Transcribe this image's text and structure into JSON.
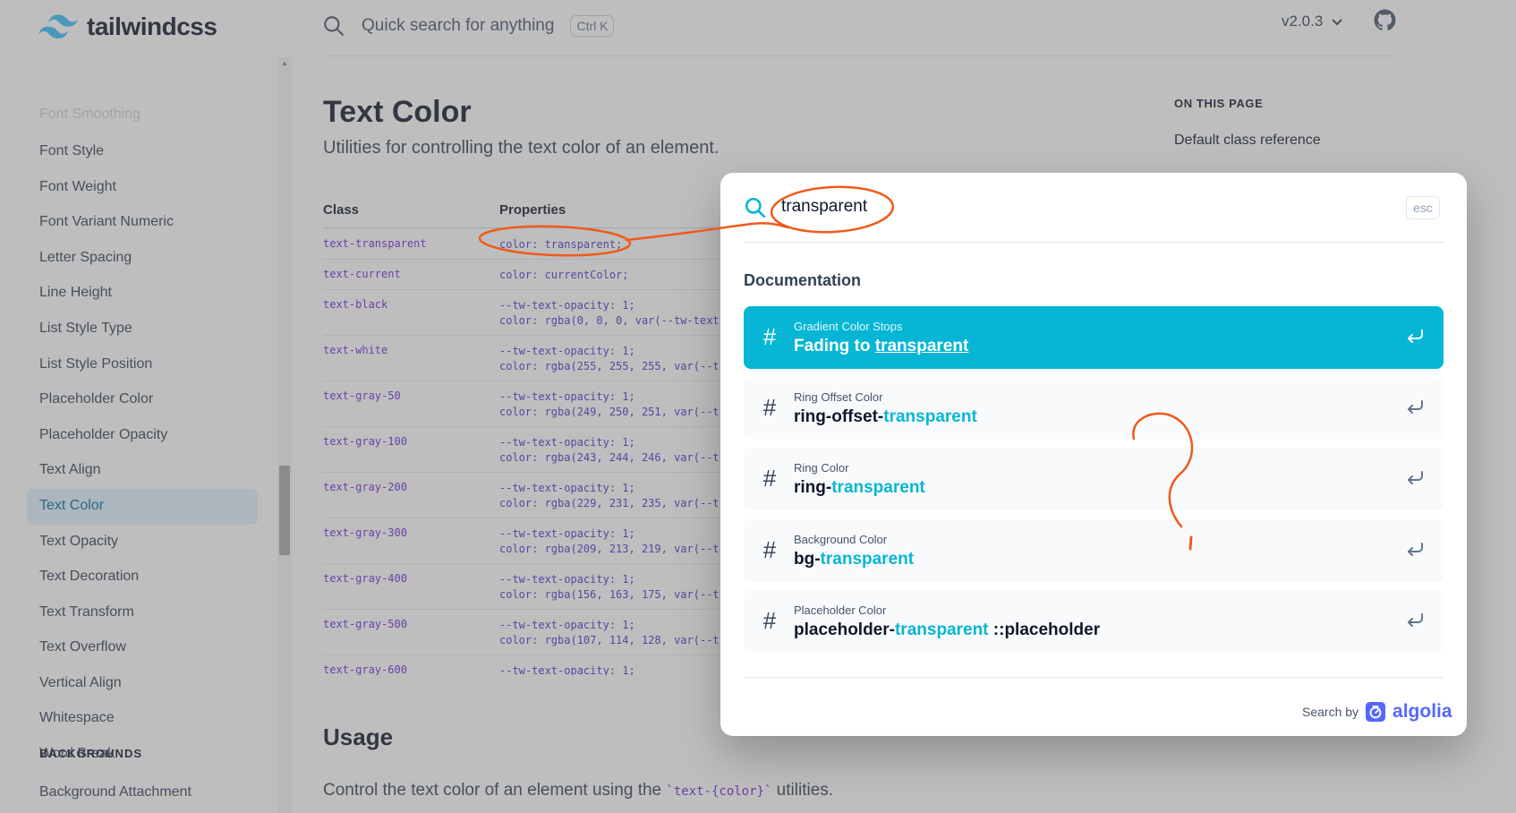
{
  "header": {
    "logo_text": "tailwindcss",
    "search_placeholder": "Quick search for anything",
    "search_shortcut": "Ctrl K",
    "version": "v2.0.3"
  },
  "sidebar": {
    "items": [
      {
        "label": "Font Smoothing"
      },
      {
        "label": "Font Style"
      },
      {
        "label": "Font Weight"
      },
      {
        "label": "Font Variant Numeric"
      },
      {
        "label": "Letter Spacing"
      },
      {
        "label": "Line Height"
      },
      {
        "label": "List Style Type"
      },
      {
        "label": "List Style Position"
      },
      {
        "label": "Placeholder Color"
      },
      {
        "label": "Placeholder Opacity"
      },
      {
        "label": "Text Align"
      },
      {
        "label": "Text Color"
      },
      {
        "label": "Text Opacity"
      },
      {
        "label": "Text Decoration"
      },
      {
        "label": "Text Transform"
      },
      {
        "label": "Text Overflow"
      },
      {
        "label": "Vertical Align"
      },
      {
        "label": "Whitespace"
      },
      {
        "label": "Word Break"
      }
    ],
    "active_item": "Text Color",
    "section_heading": "BACKGROUNDS",
    "section_first_item": "Background Attachment"
  },
  "main": {
    "title": "Text Color",
    "subtitle": "Utilities for controlling the text color of an element.",
    "table": {
      "headers": [
        "Class",
        "Properties"
      ],
      "rows": [
        {
          "cls": "text-transparent",
          "prop": "color: transparent;"
        },
        {
          "cls": "text-current",
          "prop": "color: currentColor;"
        },
        {
          "cls": "text-black",
          "prop": "--tw-text-opacity: 1;\ncolor: rgba(0, 0, 0, var(--tw-text"
        },
        {
          "cls": "text-white",
          "prop": "--tw-text-opacity: 1;\ncolor: rgba(255, 255, 255, var(--t"
        },
        {
          "cls": "text-gray-50",
          "prop": "--tw-text-opacity: 1;\ncolor: rgba(249, 250, 251, var(--t"
        },
        {
          "cls": "text-gray-100",
          "prop": "--tw-text-opacity: 1;\ncolor: rgba(243, 244, 246, var(--t"
        },
        {
          "cls": "text-gray-200",
          "prop": "--tw-text-opacity: 1;\ncolor: rgba(229, 231, 235, var(--t"
        },
        {
          "cls": "text-gray-300",
          "prop": "--tw-text-opacity: 1;\ncolor: rgba(209, 213, 219, var(--t"
        },
        {
          "cls": "text-gray-400",
          "prop": "--tw-text-opacity: 1;\ncolor: rgba(156, 163, 175, var(--t"
        },
        {
          "cls": "text-gray-500",
          "prop": "--tw-text-opacity: 1;\ncolor: rgba(107, 114, 128, var(--t"
        },
        {
          "cls": "text-gray-600",
          "prop": "--tw-text-opacity: 1;"
        }
      ]
    },
    "on_this_page": "ON THIS PAGE",
    "on_this_page_link": "Default class reference",
    "usage_heading": "Usage",
    "usage_text_before": "Control the text color of an element using the ",
    "usage_code": "`text-{color}`",
    "usage_text_after": " utilities."
  },
  "modal": {
    "query": "transparent",
    "esc_label": "esc",
    "section_label": "Documentation",
    "hits": [
      {
        "category": "Gradient Color Stops",
        "prefix": "Fading to ",
        "match": "transparent",
        "suffix": ""
      },
      {
        "category": "Ring Offset Color",
        "prefix": "ring-offset-",
        "match": "transparent",
        "suffix": ""
      },
      {
        "category": "Ring Color",
        "prefix": "ring-",
        "match": "transparent",
        "suffix": ""
      },
      {
        "category": "Background Color",
        "prefix": "bg-",
        "match": "transparent",
        "suffix": ""
      },
      {
        "category": "Placeholder Color",
        "prefix": "placeholder-",
        "match": "transparent",
        "suffix": " ::placeholder"
      }
    ],
    "search_by_label": "Search by",
    "provider": "algolia"
  },
  "colors": {
    "accent": "#06b6d4",
    "annotation": "#f05a1a",
    "algolia": "#5468ff"
  },
  "icons": {
    "logo": "tailwind-wave-icon",
    "search": "search-icon",
    "version_dropdown": "chevron-down-icon",
    "github": "github-icon",
    "hit": "hash-icon",
    "hit_action": "enter-icon",
    "provider": "algolia-icon"
  }
}
